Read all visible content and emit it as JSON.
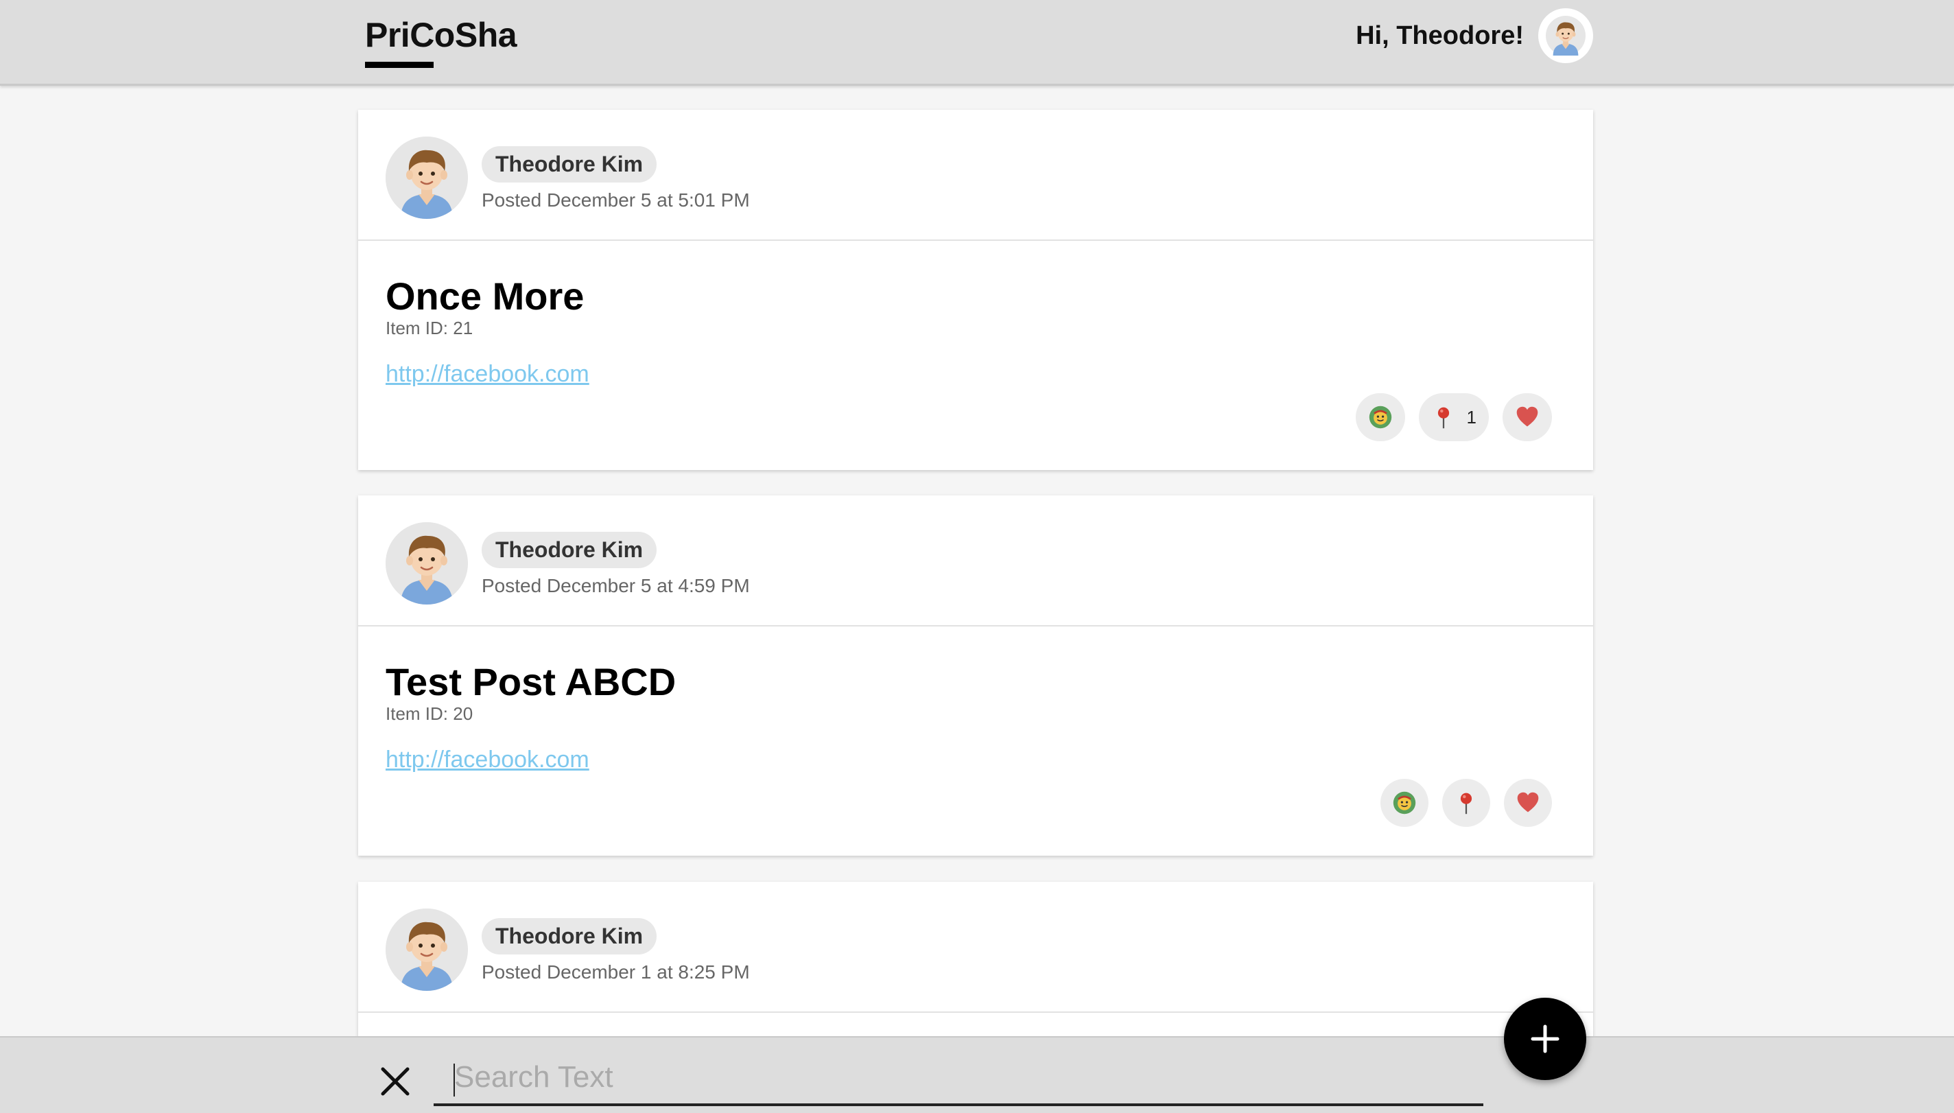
{
  "header": {
    "brand": "PriCoSha",
    "greeting": "Hi, Theodore!",
    "avatar_icon": "user-avatar-icon"
  },
  "posts": [
    {
      "author": "Theodore Kim",
      "posted": "Posted December 5 at 5:01 PM",
      "title": "Once More",
      "item_id": "Item ID: 21",
      "link": "http://facebook.com",
      "tag_count": "1"
    },
    {
      "author": "Theodore Kim",
      "posted": "Posted December 5 at 4:59 PM",
      "title": "Test Post ABCD",
      "item_id": "Item ID: 20",
      "link": "http://facebook.com",
      "tag_count": ""
    },
    {
      "author": "Theodore Kim",
      "posted": "Posted December 1 at 8:25 PM"
    }
  ],
  "search": {
    "placeholder": "Search Text",
    "value": ""
  },
  "colors": {
    "header_bg": "#dddddd",
    "link": "#7ec8ee",
    "heart": "#d9534f",
    "fab": "#000000"
  }
}
